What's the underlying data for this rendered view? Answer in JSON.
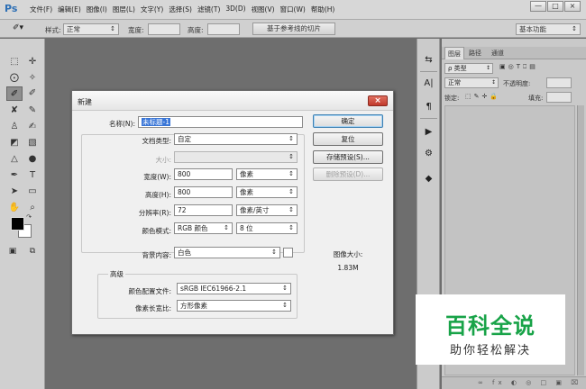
{
  "app": {
    "logo": "Ps"
  },
  "menubar": {
    "items": [
      "文件(F)",
      "编辑(E)",
      "图像(I)",
      "图层(L)",
      "文字(Y)",
      "选择(S)",
      "滤镜(T)",
      "3D(D)",
      "视图(V)",
      "窗口(W)",
      "帮助(H)"
    ],
    "window_buttons": [
      "—",
      "□",
      "×"
    ]
  },
  "options_bar": {
    "style_label": "样式:",
    "style_value": "正常",
    "width_label": "宽度:",
    "height_label": "高度:",
    "refine_button": "基于参考线的切片",
    "workspace": "基本功能"
  },
  "layers_panel": {
    "tabs": [
      "图层",
      "路径",
      "通道"
    ],
    "kind_value": "ρ 类型",
    "blend_mode": "正常",
    "opacity_label": "不透明度:",
    "lock_label": "锁定:",
    "fill_label": "填充:"
  },
  "dialog": {
    "title": "新建",
    "close": "×",
    "name_label": "名称(N):",
    "name_value": "未标题-1",
    "preset_label": "文档类型:",
    "preset_value": "自定",
    "size_label": "大小:",
    "size_value": "",
    "width_label": "宽度(W):",
    "width_value": "800",
    "width_unit": "像素",
    "height_label": "高度(H):",
    "height_value": "800",
    "height_unit": "像素",
    "resolution_label": "分辨率(R):",
    "resolution_value": "72",
    "resolution_unit": "像素/英寸",
    "color_mode_label": "颜色模式:",
    "color_mode_value": "RGB 颜色",
    "bit_depth_value": "8 位",
    "background_label": "背景内容:",
    "background_value": "白色",
    "advanced_title": "高级",
    "color_profile_label": "颜色配置文件:",
    "color_profile_value": "sRGB IEC61966-2.1",
    "pixel_aspect_label": "像素长宽比:",
    "pixel_aspect_value": "方形像素",
    "ok_button": "确定",
    "reset_button": "复位",
    "save_preset_button": "存储预设(S)...",
    "delete_preset_button": "删除预设(D)...",
    "image_size_label": "图像大小:",
    "image_size_value": "1.83M"
  },
  "watermark": {
    "title": "百科全说",
    "subtitle": "助你轻松解决"
  }
}
